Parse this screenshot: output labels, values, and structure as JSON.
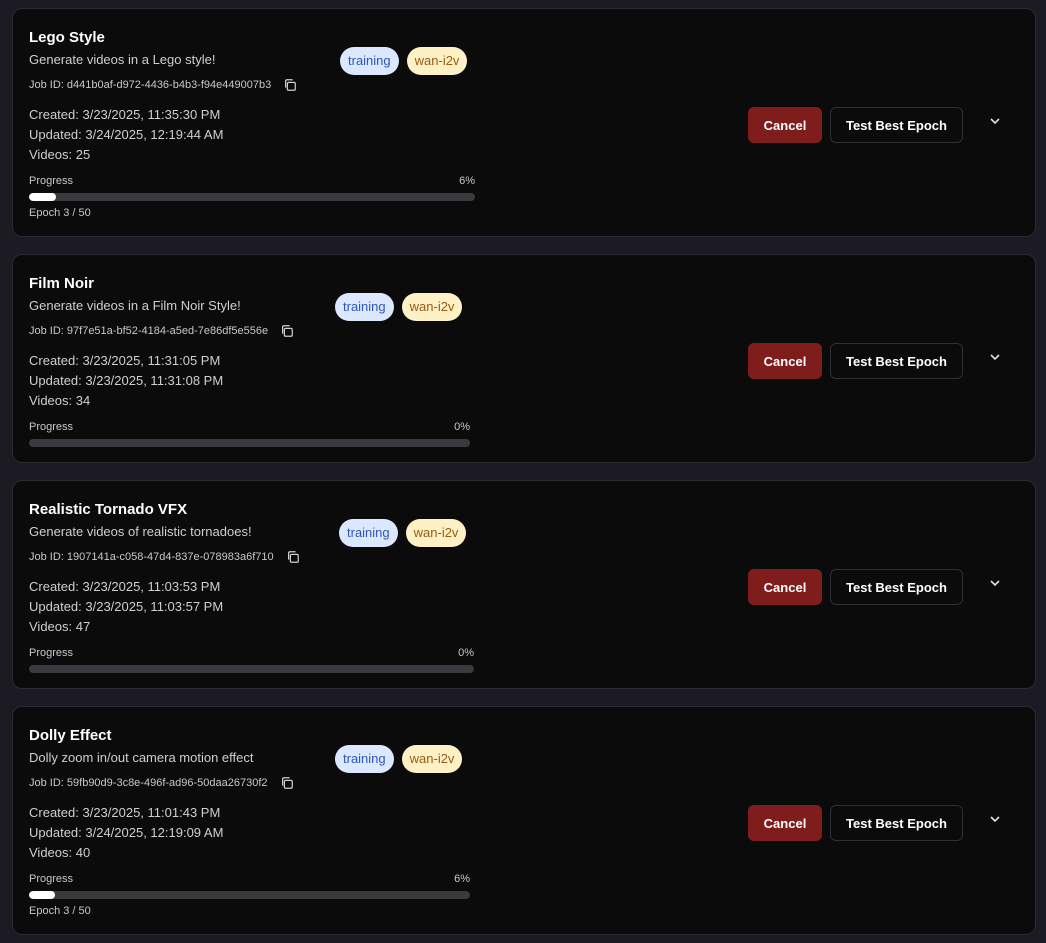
{
  "jobs": [
    {
      "title": "Lego Style",
      "description": "Generate videos in a Lego style!",
      "job_id": "Job ID: d441b0af-d972-4436-b4b3-f94e449007b3",
      "status_badge": "training",
      "model_badge": "wan-i2v",
      "created": "Created: 3/23/2025, 11:35:30 PM",
      "updated": "Updated: 3/24/2025, 12:19:44 AM",
      "videos": "Videos: 25",
      "progress_label": "Progress",
      "progress_text": "6%",
      "progress": 0.06,
      "epoch": "Epoch 3 / 50",
      "cancel_label": "Cancel",
      "test_label": "Test Best Epoch"
    },
    {
      "title": "Film Noir",
      "description": "Generate videos in a Film Noir Style!",
      "job_id": "Job ID: 97f7e51a-bf52-4184-a5ed-7e86df5e556e",
      "status_badge": "training",
      "model_badge": "wan-i2v",
      "created": "Created: 3/23/2025, 11:31:05 PM",
      "updated": "Updated: 3/23/2025, 11:31:08 PM",
      "videos": "Videos: 34",
      "progress_label": "Progress",
      "progress_text": "0%",
      "progress": 0,
      "epoch": "",
      "cancel_label": "Cancel",
      "test_label": "Test Best Epoch"
    },
    {
      "title": "Realistic Tornado VFX",
      "description": "Generate videos of realistic tornadoes!",
      "job_id": "Job ID: 1907141a-c058-47d4-837e-078983a6f710",
      "status_badge": "training",
      "model_badge": "wan-i2v",
      "created": "Created: 3/23/2025, 11:03:53 PM",
      "updated": "Updated: 3/23/2025, 11:03:57 PM",
      "videos": "Videos: 47",
      "progress_label": "Progress",
      "progress_text": "0%",
      "progress": 0,
      "epoch": "",
      "cancel_label": "Cancel",
      "test_label": "Test Best Epoch"
    },
    {
      "title": "Dolly Effect",
      "description": "Dolly zoom in/out camera motion effect",
      "job_id": "Job ID: 59fb90d9-3c8e-496f-ad96-50daa26730f2",
      "status_badge": "training",
      "model_badge": "wan-i2v",
      "created": "Created: 3/23/2025, 11:01:43 PM",
      "updated": "Updated: 3/24/2025, 12:19:09 AM",
      "videos": "Videos: 40",
      "progress_label": "Progress",
      "progress_text": "6%",
      "progress": 0.06,
      "epoch": "Epoch 3 / 50",
      "cancel_label": "Cancel",
      "test_label": "Test Best Epoch"
    }
  ],
  "icons": {
    "copy": "copy-icon",
    "expand": "chevron-down-icon"
  },
  "colors": {
    "cancel_bg": "#7f1d1d",
    "training_badge_bg": "#dbe8ff",
    "training_badge_text": "#2f57b8",
    "model_badge_bg": "#fdf1c5",
    "model_badge_text": "#9a5a12",
    "progress_fill": "#ffffff",
    "progress_track": "#3a3a3e"
  }
}
